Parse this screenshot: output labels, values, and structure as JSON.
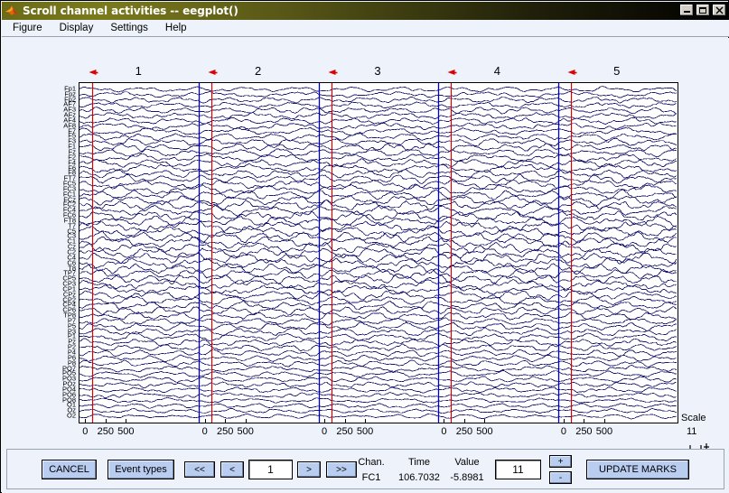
{
  "window": {
    "title": "Scroll channel activities -- eegplot()",
    "logo_name": "matlab-membrane-logo",
    "buttons": {
      "minimize": "_",
      "maximize": "□",
      "close": "✕"
    }
  },
  "menubar": {
    "items": [
      {
        "label": "Figure"
      },
      {
        "label": "Display"
      },
      {
        "label": "Settings"
      },
      {
        "label": "Help"
      }
    ]
  },
  "plot": {
    "epoch_numbers": [
      "1",
      "2",
      "3",
      "4",
      "5"
    ],
    "x_tick_labels": [
      "0",
      "250",
      "500"
    ],
    "channel_labels": [
      "Fp1",
      "Fpz",
      "Fp2",
      "AF7",
      "AF3",
      "AFz",
      "AF4",
      "AF8",
      "F7",
      "F5",
      "F3",
      "F1",
      "Fz",
      "F2",
      "F4",
      "F6",
      "F8",
      "FT7",
      "FC5",
      "FC3",
      "FC1",
      "FCz",
      "FC2",
      "FC4",
      "FC6",
      "FT8",
      "T7",
      "C5",
      "C3",
      "C1",
      "Cz",
      "C2",
      "C4",
      "C6",
      "T8",
      "TP7",
      "CP5",
      "CP3",
      "CP1",
      "CPz",
      "CP2",
      "CP4",
      "CP6",
      "TP8",
      "P7",
      "P5",
      "P3",
      "P1",
      "Pz",
      "P2",
      "P4",
      "P6",
      "P8",
      "PO7",
      "PO5",
      "PO3",
      "POz",
      "PO4",
      "PO6",
      "PO8",
      "O1",
      "Oz",
      "O2"
    ],
    "scale": {
      "title": "Scale",
      "value": "11"
    },
    "colors": {
      "trace": "#18186e",
      "epoch_line": "#0000cc",
      "event_line": "#dd0000",
      "event_flag": "#dd0000",
      "plot_background": "#ffffff",
      "window_background": "#edf2fb",
      "button_face": "#b9cdf0"
    }
  },
  "controls": {
    "cancel_label": "CANCEL",
    "event_types_label": "Event types",
    "nav_first_label": "<<",
    "nav_prev_label": "<",
    "position_value": "1",
    "nav_next_label": ">",
    "nav_last_label": ">>",
    "readout": {
      "chan_header": "Chan.",
      "time_header": "Time",
      "value_header": "Value",
      "chan_value": "FC1",
      "time_value": "106.7032",
      "value_value": "-5.8981"
    },
    "scale_field_value": "11",
    "scale_plus_label": "+",
    "scale_minus_label": "-",
    "update_marks_label": "UPDATE MARKS"
  }
}
